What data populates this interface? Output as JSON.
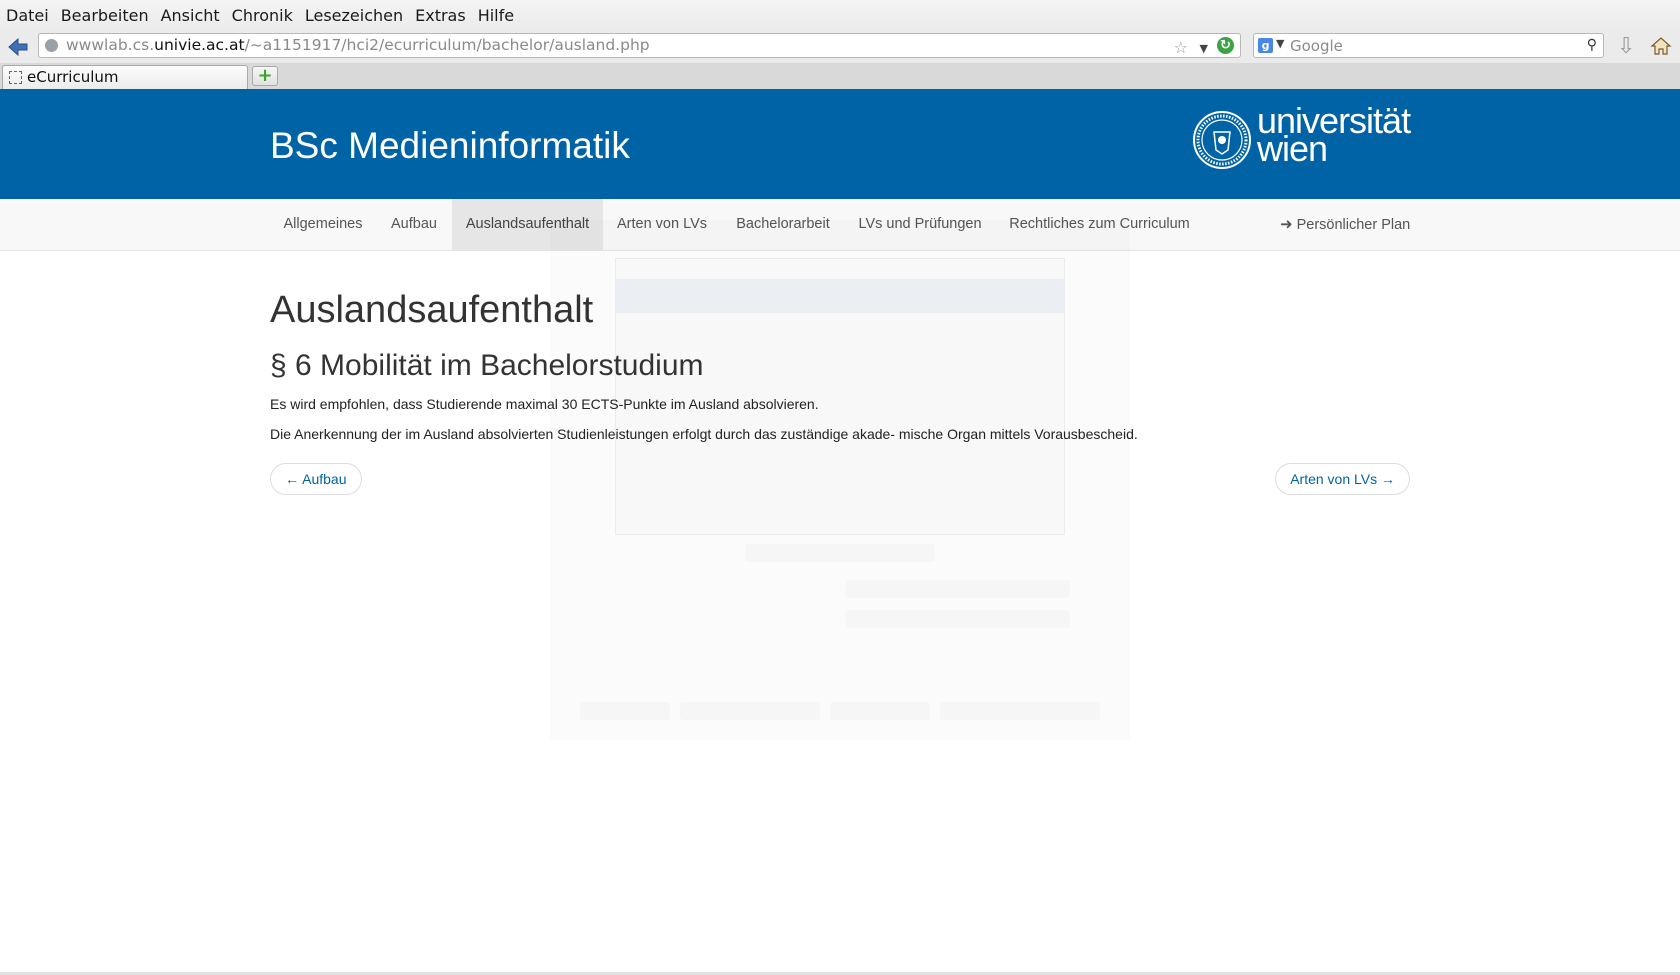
{
  "browser": {
    "menu": [
      "Datei",
      "Bearbeiten",
      "Ansicht",
      "Chronik",
      "Lesezeichen",
      "Extras",
      "Hilfe"
    ],
    "url_prefix": "wwwlab.cs.",
    "url_domain": "univie.ac.at",
    "url_path": "/~a1151917/hci2/ecurriculum/bachelor/ausland.php",
    "search_placeholder": "Google",
    "tab_title": "eCurriculum",
    "newtab_label": "+"
  },
  "header": {
    "title": "BSc Medieninformatik",
    "logo_line1": "universität",
    "logo_line2": "wien"
  },
  "nav": {
    "items": [
      {
        "label": "Allgemeines"
      },
      {
        "label": "Aufbau"
      },
      {
        "label": "Auslandsaufenthalt",
        "active": true
      },
      {
        "label": "Arten von LVs"
      },
      {
        "label": "Bachelorarbeit"
      },
      {
        "label": "LVs und Prüfungen"
      },
      {
        "label": "Rechtliches zum Curriculum"
      }
    ],
    "right_label": "Persönlicher Plan",
    "right_icon": "arrow-right-icon"
  },
  "content": {
    "title": "Auslandsaufenthalt",
    "section_title": "§ 6 Mobilität im Bachelorstudium",
    "paragraphs": [
      "Es wird empfohlen, dass Studierende maximal 30 ECTS-Punkte im Ausland absolvieren.",
      "Die Anerkennung der im Ausland absolvierten Studienleistungen erfolgt durch das zuständige akade- mische Organ mittels Vorausbescheid."
    ],
    "prev_label": "← Aufbau",
    "next_label": "Arten von LVs →"
  },
  "colors": {
    "brand_blue": "#0063a6",
    "link": "#0063a6"
  }
}
